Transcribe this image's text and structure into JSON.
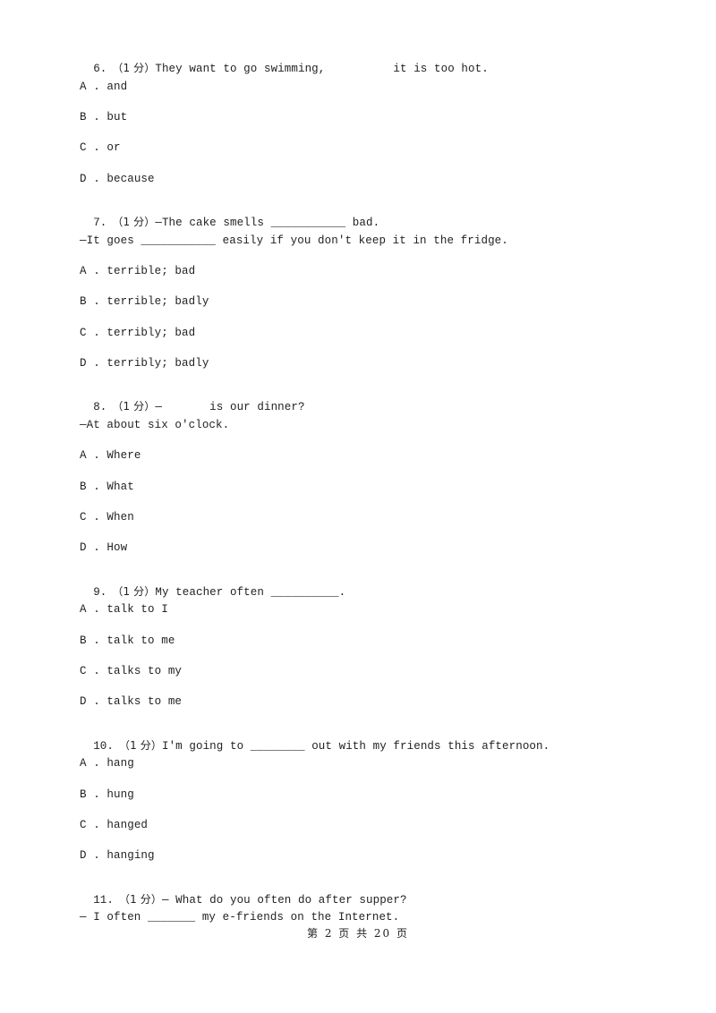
{
  "questions": [
    {
      "number": "6.",
      "score": "（1 分）",
      "stem": "They want to go swimming,          it is too hot.",
      "options": [
        {
          "letter": "A .",
          "text": "and"
        },
        {
          "letter": "B .",
          "text": "but"
        },
        {
          "letter": "C .",
          "text": "or"
        },
        {
          "letter": "D .",
          "text": "because"
        }
      ]
    },
    {
      "number": "7.",
      "score": "（1 分）",
      "stem": "—The cake smells ___________ bad.",
      "stem2": "—It goes ___________ easily if you don't keep it in the fridge.",
      "options": [
        {
          "letter": "A .",
          "text": "terrible; bad"
        },
        {
          "letter": "B .",
          "text": "terrible; badly"
        },
        {
          "letter": "C .",
          "text": "terribly; bad"
        },
        {
          "letter": "D .",
          "text": "terribly; badly"
        }
      ]
    },
    {
      "number": "8.",
      "score": "（1 分）",
      "stem": "—       is our dinner?",
      "stem2": "—At about six o'clock.",
      "options": [
        {
          "letter": "A .",
          "text": "Where"
        },
        {
          "letter": "B .",
          "text": "What"
        },
        {
          "letter": "C .",
          "text": "When"
        },
        {
          "letter": "D .",
          "text": "How"
        }
      ]
    },
    {
      "number": "9.",
      "score": "（1 分）",
      "stem": "My teacher often __________.",
      "options": [
        {
          "letter": "A .",
          "text": "talk to I"
        },
        {
          "letter": "B .",
          "text": "talk to me"
        },
        {
          "letter": "C .",
          "text": "talks to my"
        },
        {
          "letter": "D .",
          "text": "talks to me"
        }
      ]
    },
    {
      "number": "10.",
      "score": "（1 分）",
      "stem": "I'm going to ________ out with my friends this afternoon.",
      "options": [
        {
          "letter": "A .",
          "text": "hang"
        },
        {
          "letter": "B .",
          "text": "hung"
        },
        {
          "letter": "C .",
          "text": "hanged"
        },
        {
          "letter": "D .",
          "text": "hanging"
        }
      ]
    },
    {
      "number": "11.",
      "score": "（1 分）",
      "stem": "— What do you often do after supper?",
      "stem2": "— I often _______ my e-friends on the Internet."
    }
  ],
  "footer": {
    "page_label": "第 2 页 共 20 页"
  }
}
